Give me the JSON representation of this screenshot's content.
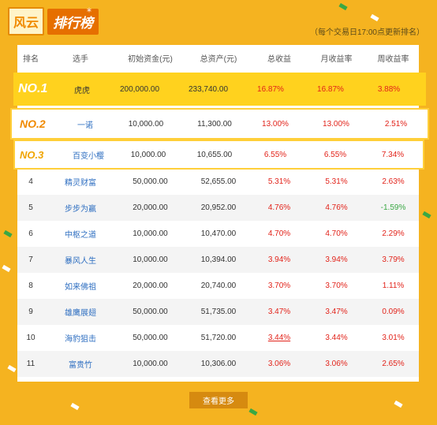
{
  "header": {
    "title_part1": "风云",
    "title_part2": "排行榜",
    "note": "（每个交易日17:00点更新排名）"
  },
  "table": {
    "columns": [
      "排名",
      "选手",
      "初始资金(元)",
      "总资产(元)",
      "总收益",
      "月收益率",
      "周收益率"
    ],
    "top": [
      {
        "rank": "NO.1",
        "name": "虎虎",
        "initial": "200,000.00",
        "assets": "233,740.00",
        "total": "16.87%",
        "month": "16.87%",
        "week": "3.88%"
      },
      {
        "rank": "NO.2",
        "name": "一诺",
        "initial": "10,000.00",
        "assets": "11,300.00",
        "total": "13.00%",
        "month": "13.00%",
        "week": "2.51%"
      },
      {
        "rank": "NO.3",
        "name": "百变小樱",
        "initial": "10,000.00",
        "assets": "10,655.00",
        "total": "6.55%",
        "month": "6.55%",
        "week": "7.34%"
      }
    ],
    "rows": [
      {
        "rank": "4",
        "name": "精灵财富",
        "initial": "50,000.00",
        "assets": "52,655.00",
        "total": "5.31%",
        "month": "5.31%",
        "week": "2.63%"
      },
      {
        "rank": "5",
        "name": "步步为赢",
        "initial": "20,000.00",
        "assets": "20,952.00",
        "total": "4.76%",
        "month": "4.76%",
        "week": "-1.59%"
      },
      {
        "rank": "6",
        "name": "中枢之道",
        "initial": "10,000.00",
        "assets": "10,470.00",
        "total": "4.70%",
        "month": "4.70%",
        "week": "2.29%"
      },
      {
        "rank": "7",
        "name": "暴风人生",
        "initial": "10,000.00",
        "assets": "10,394.00",
        "total": "3.94%",
        "month": "3.94%",
        "week": "3.79%"
      },
      {
        "rank": "8",
        "name": "如来佛祖",
        "initial": "20,000.00",
        "assets": "20,740.00",
        "total": "3.70%",
        "month": "3.70%",
        "week": "1.11%"
      },
      {
        "rank": "9",
        "name": "雄鹰展翅",
        "initial": "50,000.00",
        "assets": "51,735.00",
        "total": "3.47%",
        "month": "3.47%",
        "week": "0.09%"
      },
      {
        "rank": "10",
        "name": "海豹狙击",
        "initial": "50,000.00",
        "assets": "51,720.00",
        "total": "3.44%",
        "month": "3.44%",
        "week": "3.01%"
      },
      {
        "rank": "11",
        "name": "富贵竹",
        "initial": "10,000.00",
        "assets": "10,306.00",
        "total": "3.06%",
        "month": "3.06%",
        "week": "2.65%"
      }
    ]
  },
  "more_button": "查看更多",
  "colors": {
    "background": "#f5b320",
    "accent": "#ffd21e",
    "positive": "#e2231a",
    "negative": "#3aa844",
    "link": "#2f6fc1"
  }
}
